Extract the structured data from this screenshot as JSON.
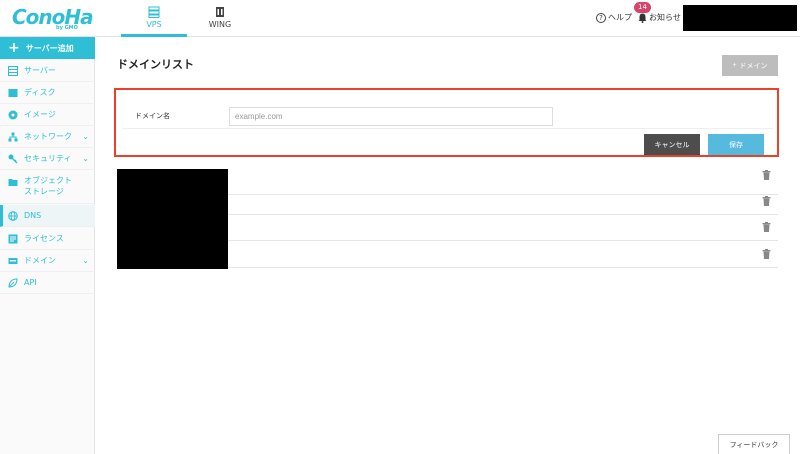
{
  "header": {
    "logo_text": "ConoHa",
    "logo_sub": "by GMO",
    "tabs": [
      {
        "label": "VPS",
        "icon": "server-stack-icon",
        "active": true
      },
      {
        "label": "WING",
        "icon": "wing-building-icon",
        "active": false
      }
    ],
    "help_label": "ヘルプ",
    "notice_label": "お知らせ",
    "notice_count": "14"
  },
  "sidebar": {
    "add_label": "サーバー追加",
    "items": [
      {
        "label": "サーバー",
        "icon": "server-icon"
      },
      {
        "label": "ディスク",
        "icon": "disk-icon"
      },
      {
        "label": "イメージ",
        "icon": "image-icon"
      },
      {
        "label": "ネットワーク",
        "icon": "network-icon",
        "expandable": true
      },
      {
        "label": "セキュリティ",
        "icon": "key-icon",
        "expandable": true
      },
      {
        "label": "オブジェクト",
        "label2": "ストレージ",
        "icon": "folder-icon"
      },
      {
        "label": "DNS",
        "icon": "globe-icon",
        "active": true
      },
      {
        "label": "ライセンス",
        "icon": "license-icon"
      },
      {
        "label": "ドメイン",
        "icon": "domain-icon",
        "expandable": true
      },
      {
        "label": "API",
        "icon": "api-icon"
      }
    ]
  },
  "main": {
    "title": "ドメインリスト",
    "add_domain_label": "ドメイン",
    "form": {
      "label": "ドメイン名",
      "placeholder": "example.com",
      "value": "",
      "cancel_label": "キャンセル",
      "save_label": "保存"
    },
    "row_count": 4
  },
  "feedback_label": "フィードバック",
  "colors": {
    "accent": "#2ebfd6",
    "highlight_border": "#e8412c",
    "save_button": "#56b9de",
    "cancel_button": "#4d4d4d",
    "badge": "#d6436b"
  }
}
